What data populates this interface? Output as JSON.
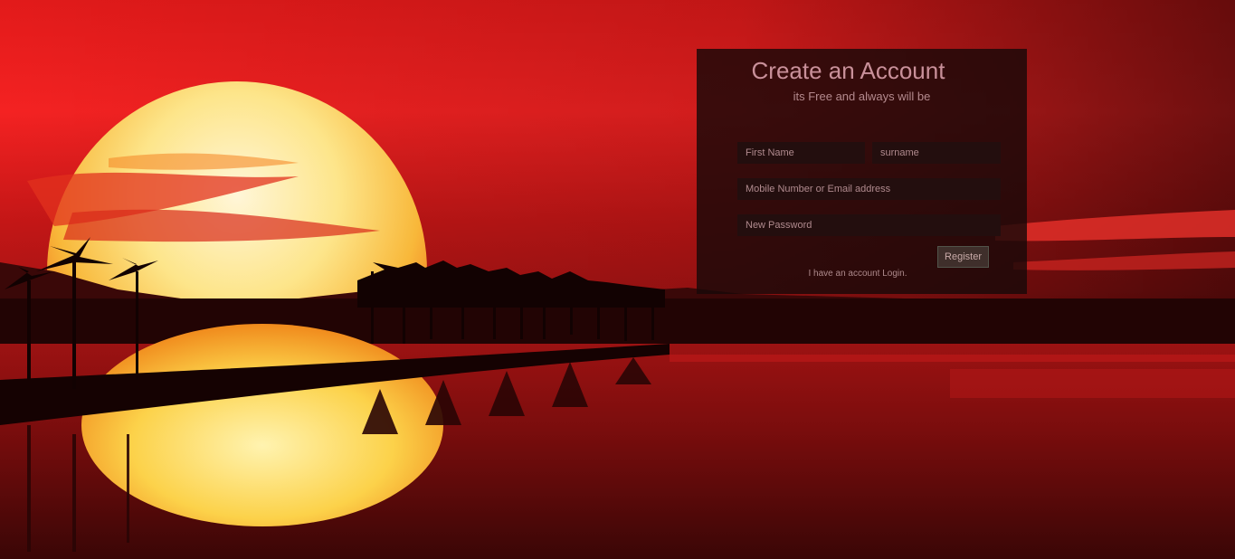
{
  "form": {
    "title": "Create an Account",
    "subtitle": "its Free and always will be",
    "first_name_placeholder": "First Name",
    "surname_placeholder": "surname",
    "contact_placeholder": "Mobile Number or Email address",
    "password_placeholder": "New Password",
    "register_label": "Register",
    "login_link": "I have an account Login."
  },
  "background": {
    "description_colors": {
      "sky": "#f42222",
      "sun": "#fff3c4",
      "panel": "#190808"
    }
  }
}
